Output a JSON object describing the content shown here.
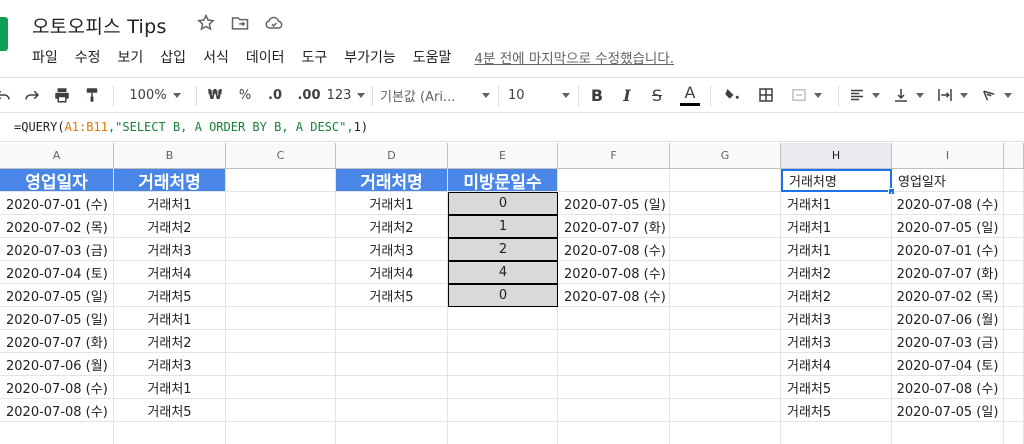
{
  "window": {
    "doc_title": "오토오피스 Tips"
  },
  "menu": {
    "items": [
      "파일",
      "수정",
      "보기",
      "삽입",
      "서식",
      "데이터",
      "도구",
      "부가기능",
      "도움말"
    ],
    "last_edit": "4분 전에 마지막으로 수정했습니다."
  },
  "toolbar": {
    "zoom": "100%",
    "currency": "₩",
    "percent": "%",
    "dec_less": ".0",
    "dec_more": ".00",
    "more_formats": "123",
    "font": "기본값 (Ari...",
    "font_size": "10",
    "bold": "B",
    "italic": "I",
    "strike": "S",
    "text_color": "A"
  },
  "formula_bar": {
    "parts": [
      "=QUERY(",
      "A1:B11",
      ",\"SELECT B, A ORDER BY B, A DESC\",",
      "1",
      ")"
    ]
  },
  "sheet": {
    "columns": [
      "A",
      "B",
      "C",
      "D",
      "E",
      "F",
      "G",
      "H",
      "I"
    ],
    "selected_column": "H",
    "headers": {
      "A1": "영업일자",
      "B1": "거래처명",
      "D1": "거래처명",
      "E1": "미방문일수",
      "H1": "거래처명",
      "I1": "영업일자"
    },
    "colA": [
      "2020-07-01 (수)",
      "2020-07-02 (목)",
      "2020-07-03 (금)",
      "2020-07-04 (토)",
      "2020-07-05 (일)",
      "2020-07-05 (일)",
      "2020-07-07 (화)",
      "2020-07-06 (월)",
      "2020-07-08 (수)",
      "2020-07-08 (수)"
    ],
    "colB": [
      "거래처1",
      "거래처2",
      "거래처3",
      "거래처4",
      "거래처5",
      "거래처1",
      "거래처2",
      "거래처3",
      "거래처1",
      "거래처5"
    ],
    "colD": [
      "거래처1",
      "거래처2",
      "거래처3",
      "거래처4",
      "거래처5"
    ],
    "colE": [
      "0",
      "1",
      "2",
      "4",
      "0"
    ],
    "colF": [
      "2020-07-05 (일)",
      "2020-07-07 (화)",
      "2020-07-08 (수)",
      "2020-07-08 (수)",
      "2020-07-08 (수)"
    ],
    "colH": [
      "거래처1",
      "거래처1",
      "거래처1",
      "거래처2",
      "거래처2",
      "거래처3",
      "거래처3",
      "거래처4",
      "거래처5",
      "거래처5"
    ],
    "colI": [
      "2020-07-08 (수)",
      "2020-07-05 (일)",
      "2020-07-01 (수)",
      "2020-07-07 (화)",
      "2020-07-02 (목)",
      "2020-07-06 (월)",
      "2020-07-03 (금)",
      "2020-07-04 (토)",
      "2020-07-08 (수)",
      "2020-07-05 (일)"
    ]
  },
  "colors": {
    "header_blue": "#4a86e8",
    "gray_fill": "#d9d9d9",
    "selection": "#1a73e8"
  }
}
